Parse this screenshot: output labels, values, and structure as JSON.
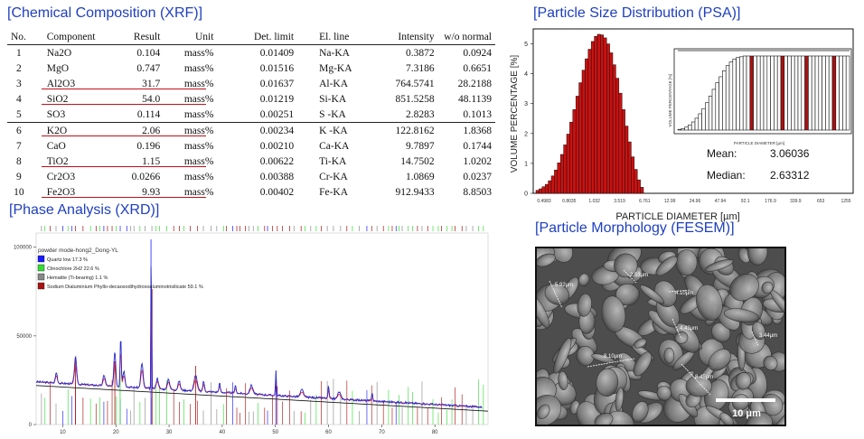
{
  "headings": {
    "xrf": "[Chemical Composition (XRF)]",
    "xrd": "[Phase Analysis (XRD)]",
    "psa": "[Particle Size Distribution (PSA)]",
    "fesem": "[Particle Morphology  (FESEM)]"
  },
  "xrf": {
    "columns": [
      "No.",
      "Component",
      "Result",
      "Unit",
      "Det. limit",
      "El. line",
      "Intensity",
      "w/o normal"
    ],
    "rows": [
      [
        "1",
        "Na2O",
        "0.104",
        "mass%",
        "0.01409",
        "Na-KA",
        "0.3872",
        "0.0924"
      ],
      [
        "2",
        "MgO",
        "0.747",
        "mass%",
        "0.01516",
        "Mg-KA",
        "7.3186",
        "0.6651"
      ],
      [
        "3",
        "Al2O3",
        "31.7",
        "mass%",
        "0.01637",
        "Al-KA",
        "764.5741",
        "28.2188"
      ],
      [
        "4",
        "SiO2",
        "54.0",
        "mass%",
        "0.01219",
        "Si-KA",
        "851.5258",
        "48.1139"
      ],
      [
        "5",
        "SO3",
        "0.114",
        "mass%",
        "0.00251",
        "S -KA",
        "2.8283",
        "0.1013"
      ],
      [
        "6",
        "K2O",
        "2.06",
        "mass%",
        "0.00234",
        "K -KA",
        "122.8162",
        "1.8368"
      ],
      [
        "7",
        "CaO",
        "0.196",
        "mass%",
        "0.00210",
        "Ca-KA",
        "9.7897",
        "0.1744"
      ],
      [
        "8",
        "TiO2",
        "1.15",
        "mass%",
        "0.00622",
        "Ti-KA",
        "14.7502",
        "1.0202"
      ],
      [
        "9",
        "Cr2O3",
        "0.0266",
        "mass%",
        "0.00388",
        "Cr-KA",
        "1.0869",
        "0.0237"
      ],
      [
        "10",
        "Fe2O3",
        "9.93",
        "mass%",
        "0.00402",
        "Fe-KA",
        "912.9433",
        "8.8503"
      ]
    ],
    "highlight_color": "#c0101a"
  },
  "xrd": {
    "title": "powder mode-hong2_Dong-YL",
    "legend": [
      {
        "label": "Quartz low 17.3 %",
        "color": "#1a1aff"
      },
      {
        "label": "Clinochlore 2H2 22.6 %",
        "color": "#33dd33"
      },
      {
        "label": "Hematite (Ti-bearing) 1.1 %",
        "color": "#888888"
      },
      {
        "label": "Sodium Dialuminium Phyllo-decaoxodihydroxoaluminotrisilicate 59.1 %",
        "color": "#aa1111"
      }
    ],
    "y_ticks": [
      "100000",
      "50000",
      "0"
    ],
    "x_ticks": [
      "10",
      "20",
      "30",
      "40",
      "50",
      "60",
      "70",
      "80"
    ]
  },
  "chart_data": {
    "type": "bar",
    "ylabel": "VOLUME PERCENTAGE [%]",
    "xlabel": "PARTICLE DIAMETER [µm]",
    "y_ticks": [
      "0",
      "1",
      "2",
      "3",
      "4",
      "5"
    ],
    "x_ticks": [
      "0.4983",
      "0.8035",
      "1.032",
      "3.519",
      "6.761",
      "12.99",
      "24.96",
      "47.94",
      "92.1",
      "176.9",
      "339.9",
      "653",
      "1255"
    ],
    "ylim": [
      0,
      5.5
    ],
    "values": [
      0.1,
      0.15,
      0.22,
      0.3,
      0.42,
      0.58,
      0.78,
      1.02,
      1.3,
      1.62,
      1.98,
      2.38,
      2.8,
      3.25,
      3.7,
      4.12,
      4.5,
      4.82,
      5.08,
      5.25,
      5.32,
      5.3,
      5.2,
      5.0,
      4.7,
      4.3,
      3.85,
      3.35,
      2.8,
      2.25,
      1.72,
      1.22,
      0.8,
      0.45,
      0.2
    ],
    "inset": {
      "ylabel": "VOLUME PERCENTAGE [%]",
      "xlabel": "PARTICLE DIAMETER [µm]",
      "cumulative": [
        0.01,
        0.02,
        0.04,
        0.07,
        0.11,
        0.16,
        0.22,
        0.29,
        0.37,
        0.46,
        0.55,
        0.64,
        0.72,
        0.8,
        0.87,
        0.92,
        0.96,
        0.98,
        0.99,
        1,
        1,
        1,
        1,
        1,
        1,
        1,
        1,
        1,
        1,
        1,
        1,
        1,
        1,
        1,
        1,
        1,
        1,
        1,
        1,
        1,
        1,
        1,
        1,
        1,
        1,
        1,
        1,
        1,
        1,
        1
      ]
    },
    "stats": [
      {
        "label": "Mean:",
        "value": "3.06036"
      },
      {
        "label": "Median:",
        "value": "2.63312"
      }
    ]
  },
  "fesem": {
    "annotations": [
      "5.92μm",
      "2.53μm",
      "4.10μm",
      "4.43μm",
      "8.10μm",
      "8.45μm",
      "3.44μm"
    ],
    "scale_label": "10 μm"
  }
}
